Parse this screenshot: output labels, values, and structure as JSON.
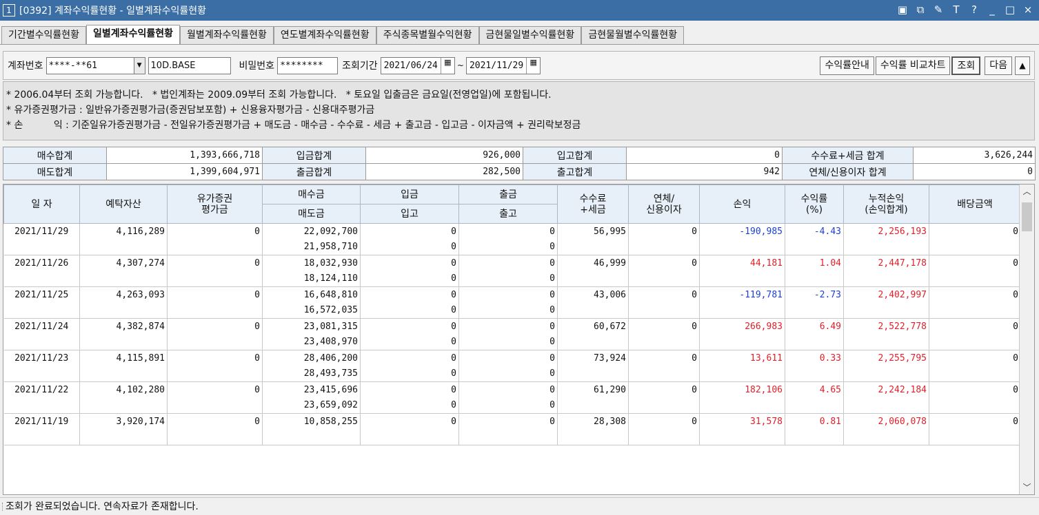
{
  "window": {
    "number": "1",
    "title": "[0392] 계좌수익률현황 - 일별계좌수익률현황"
  },
  "tabs": [
    {
      "label": "기간별수익률현황",
      "active": false
    },
    {
      "label": "일별계좌수익률현황",
      "active": true
    },
    {
      "label": "월별계좌수익률현황",
      "active": false
    },
    {
      "label": "연도별계좌수익률현황",
      "active": false
    },
    {
      "label": "주식종목별월수익현황",
      "active": false
    },
    {
      "label": "금현물일별수익률현황",
      "active": false
    },
    {
      "label": "금현물월별수익률현황",
      "active": false
    }
  ],
  "query": {
    "account_label": "계좌번호",
    "account_value": "****-**61",
    "account_name": "10D.BASE",
    "password_label": "비밀번호",
    "password_value": "********",
    "period_label": "조회기간",
    "date_from": "2021/06/24",
    "tilde": "~",
    "date_to": "2021/11/29",
    "btn_guide": "수익률안내",
    "btn_compare": "수익률 비교차트",
    "btn_search": "조회",
    "btn_next": "다음",
    "btn_collapse": "▲"
  },
  "notes": [
    "* 2006.04부터 조회 가능합니다.   * 법인계좌는 2009.09부터 조회 가능합니다.   * 토요일 입출금은 금요일(전영업일)에 포함됩니다.",
    "* 유가증권평가금 : 일반유가증권평가금(증권담보포함) + 신용융자평가금 - 신용대주평가금",
    "* 손          익 : 기준일유가증권평가금 - 전일유가증권평가금 + 매도금 - 매수금 - 수수료 - 세금 + 출고금 - 입고금 - 이자금액 + 권리락보정금"
  ],
  "summary": {
    "buy_total_label": "매수합계",
    "buy_total": "1,393,666,718",
    "deposit_total_label": "입금합계",
    "deposit_total": "926,000",
    "stock_in_total_label": "입고합계",
    "stock_in_total": "0",
    "fee_tax_label": "수수료+세금 합계",
    "fee_tax": "3,626,244",
    "sell_total_label": "매도합계",
    "sell_total": "1,399,604,971",
    "withdraw_total_label": "출금합계",
    "withdraw_total": "282,500",
    "stock_out_total_label": "출고합계",
    "stock_out_total": "942",
    "interest_label": "연체/신용이자 합계",
    "interest": "0"
  },
  "grid": {
    "headers": {
      "date": "일 자",
      "deposit_asset": "예탁자산",
      "securities_1": "유가증권",
      "securities_2": "평가금",
      "buy": "매수금",
      "sell": "매도금",
      "deposit_in": "입금",
      "stock_in": "입고",
      "withdraw": "출금",
      "stock_out": "출고",
      "fee_1": "수수료",
      "fee_2": "+세금",
      "interest_1": "연체/",
      "interest_2": "신용이자",
      "pnl": "손익",
      "rate_1": "수익률",
      "rate_2": "(%)",
      "cum_1": "누적손익",
      "cum_2": "(손익합계)",
      "dividend": "배당금액"
    },
    "rows": [
      {
        "date": "2021/11/29",
        "asset": "4,116,289",
        "sec": "0",
        "buy": "22,092,700",
        "sell": "21,958,710",
        "dep": "0",
        "sin": "0",
        "wd": "0",
        "sout": "0",
        "fee": "56,995",
        "int": "0",
        "pnl": "-190,985",
        "rate": "-4.43",
        "cum": "2,256,193",
        "div": "0",
        "sign": "neg"
      },
      {
        "date": "2021/11/26",
        "asset": "4,307,274",
        "sec": "0",
        "buy": "18,032,930",
        "sell": "18,124,110",
        "dep": "0",
        "sin": "0",
        "wd": "0",
        "sout": "0",
        "fee": "46,999",
        "int": "0",
        "pnl": "44,181",
        "rate": "1.04",
        "cum": "2,447,178",
        "div": "0",
        "sign": "pos"
      },
      {
        "date": "2021/11/25",
        "asset": "4,263,093",
        "sec": "0",
        "buy": "16,648,810",
        "sell": "16,572,035",
        "dep": "0",
        "sin": "0",
        "wd": "0",
        "sout": "0",
        "fee": "43,006",
        "int": "0",
        "pnl": "-119,781",
        "rate": "-2.73",
        "cum": "2,402,997",
        "div": "0",
        "sign": "neg"
      },
      {
        "date": "2021/11/24",
        "asset": "4,382,874",
        "sec": "0",
        "buy": "23,081,315",
        "sell": "23,408,970",
        "dep": "0",
        "sin": "0",
        "wd": "0",
        "sout": "0",
        "fee": "60,672",
        "int": "0",
        "pnl": "266,983",
        "rate": "6.49",
        "cum": "2,522,778",
        "div": "0",
        "sign": "pos"
      },
      {
        "date": "2021/11/23",
        "asset": "4,115,891",
        "sec": "0",
        "buy": "28,406,200",
        "sell": "28,493,735",
        "dep": "0",
        "sin": "0",
        "wd": "0",
        "sout": "0",
        "fee": "73,924",
        "int": "0",
        "pnl": "13,611",
        "rate": "0.33",
        "cum": "2,255,795",
        "div": "0",
        "sign": "pos"
      },
      {
        "date": "2021/11/22",
        "asset": "4,102,280",
        "sec": "0",
        "buy": "23,415,696",
        "sell": "23,659,092",
        "dep": "0",
        "sin": "0",
        "wd": "0",
        "sout": "0",
        "fee": "61,290",
        "int": "0",
        "pnl": "182,106",
        "rate": "4.65",
        "cum": "2,242,184",
        "div": "0",
        "sign": "pos"
      },
      {
        "date": "2021/11/19",
        "asset": "3,920,174",
        "sec": "0",
        "buy": "10,858,255",
        "sell": "",
        "dep": "0",
        "sin": "",
        "wd": "0",
        "sout": "",
        "fee": "28,308",
        "int": "0",
        "pnl": "31,578",
        "rate": "0.81",
        "cum": "2,060,078",
        "div": "0",
        "sign": "pos"
      }
    ]
  },
  "status": "조회가 완료되었습니다. 연속자료가 존재합니다.",
  "colors": {
    "title_bar": "#3a6ea5",
    "header_bg": "#e7f0f8",
    "negative": "#1a3fd6",
    "positive": "#e0202a"
  },
  "icons": [
    "restore-icon",
    "cascade-icon",
    "pin-icon",
    "font-icon",
    "help-icon",
    "minimize-icon",
    "maximize-icon",
    "close-icon",
    "calendar-icon",
    "dropdown-icon",
    "scroll-up-icon",
    "scroll-down-icon"
  ]
}
